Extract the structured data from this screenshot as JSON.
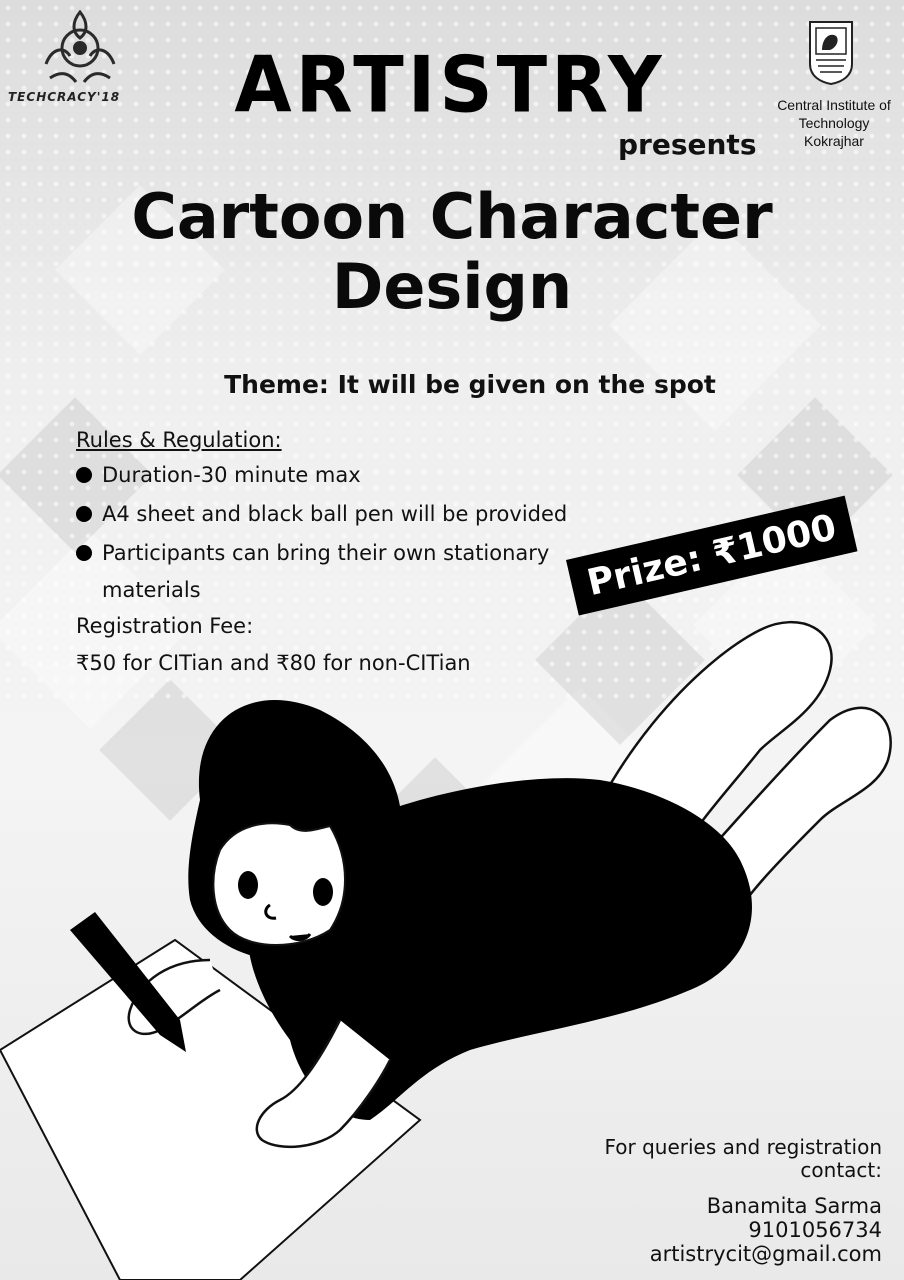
{
  "header": {
    "organizer_logo_text": "TECHCRACY'18",
    "event_brand": "ARTISTRY",
    "presents": "presents",
    "institute": {
      "line1": "Central Institute of",
      "line2": "Technology",
      "line3": "Kokrajhar"
    }
  },
  "title": {
    "line1": "Cartoon Character",
    "line2": "Design"
  },
  "theme": "Theme: It will be given on the spot",
  "rules": {
    "heading": "Rules & Regulation:",
    "items": [
      "Duration-30 minute max",
      "A4 sheet and black ball pen will be provided",
      "Participants can bring their own stationary",
      "materials"
    ]
  },
  "registration": {
    "label": "Registration Fee:",
    "fee": "₹50 for CITian and  ₹80 for non-CITian"
  },
  "prize": "Prize:  ₹1000",
  "contact": {
    "heading_line1": "For queries and registration",
    "heading_line2": "contact:",
    "name": "Banamita Sarma",
    "phone": "9101056734",
    "email": "artistrycit@gmail.com"
  },
  "icons": {
    "organizer_logo": "techcracy-emblem-icon",
    "institute_logo": "cit-crest-icon",
    "illustration": "child-drawing-illustration"
  },
  "colors": {
    "text": "#111111",
    "prize_bg": "#000000",
    "prize_text": "#ffffff"
  }
}
